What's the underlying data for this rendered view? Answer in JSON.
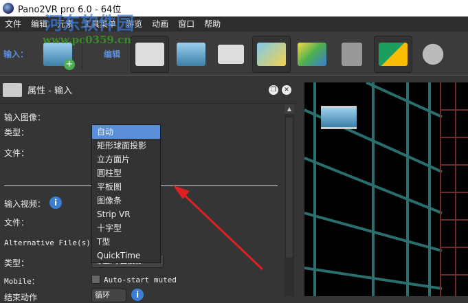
{
  "window": {
    "title": "Pano2VR pro 6.0 - 64位"
  },
  "menu": [
    "文件",
    "编辑",
    "元素",
    "工具菜单",
    "游览",
    "动画",
    "窗口",
    "帮助"
  ],
  "toolbar": {
    "input_label": "输入：",
    "edit_label": "编辑"
  },
  "panel": {
    "title": "属性 - 输入"
  },
  "form": {
    "input_image": "输入图像：",
    "type": "类型：",
    "file": "文件：",
    "input_video": "输入视频：",
    "video_file": "文件：",
    "alt_files": "Alternative File(s)：",
    "video_type": "类型：",
    "video_type_value": "等量,球面投影",
    "mobile": "Mobile：",
    "autostart": "Auto-start muted",
    "end_action": "结束动作",
    "end_action_value": "循环"
  },
  "dropdown": {
    "options": [
      "自动",
      "矩形球面投影",
      "立方面片",
      "圆柱型",
      "平板图",
      "图像条",
      "Strip VR",
      "十字型",
      "T型",
      "QuickTime"
    ],
    "selected": "自动"
  },
  "watermark": {
    "name": "河东软件园",
    "url": "www.pc0359.cn"
  },
  "colors": {
    "accent": "#5b8fd8",
    "arrow": "#e02020",
    "grid": "#2a6e6e",
    "grid_red": "#6e2a2a"
  }
}
